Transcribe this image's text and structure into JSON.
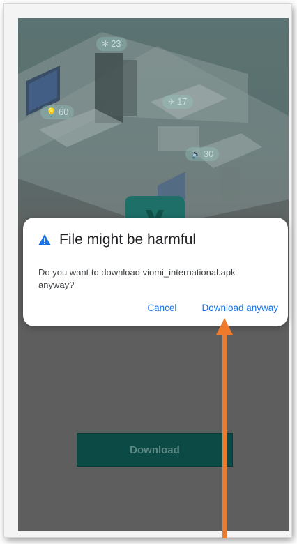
{
  "background": {
    "badges": [
      {
        "glyph": "✻",
        "value": "23"
      },
      {
        "glyph": "💡",
        "value": "60"
      },
      {
        "glyph": "✈",
        "value": "17"
      },
      {
        "glyph": "🔈",
        "value": "30"
      }
    ],
    "download_button_label": "Download"
  },
  "dialog": {
    "title": "File might be harmful",
    "message": "Do you want to download viomi_international.apk anyway?",
    "cancel_label": "Cancel",
    "confirm_label": "Download anyway",
    "icon": "warning-triangle-icon"
  },
  "colors": {
    "accent": "#1a73e8",
    "annotation_arrow": "#f07a2b",
    "scrim": "#5e5e5e"
  }
}
